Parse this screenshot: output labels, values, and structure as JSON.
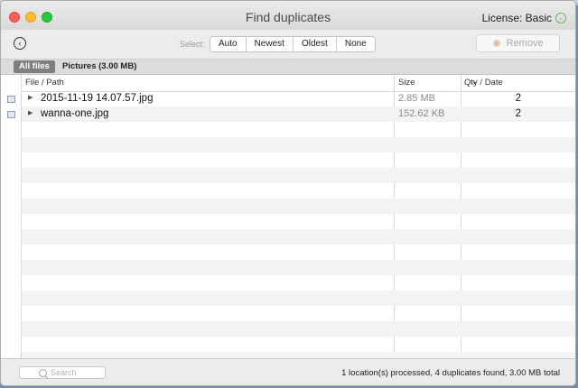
{
  "window": {
    "title": "Find duplicates",
    "license": "License: Basic"
  },
  "toolbar": {
    "select_label": "Select:",
    "select_options": [
      "Auto",
      "Newest",
      "Oldest",
      "None"
    ],
    "remove_label": "Remove"
  },
  "tabs": {
    "all_files": "All files",
    "pictures": "Pictures (3.00 MB)"
  },
  "table": {
    "columns": {
      "file_path": "File / Path",
      "size": "Size",
      "qty_date": "Qty / Date"
    },
    "rows": [
      {
        "name": "2015-11-19 14.07.57.jpg",
        "size": "2.85 MB",
        "qty": "2"
      },
      {
        "name": "wanna-one.jpg",
        "size": "152.62 KB",
        "qty": "2"
      }
    ]
  },
  "footer": {
    "search_placeholder": "Search",
    "status": "1 location(s) processed, 4 duplicates found, 3.00 MB total"
  }
}
